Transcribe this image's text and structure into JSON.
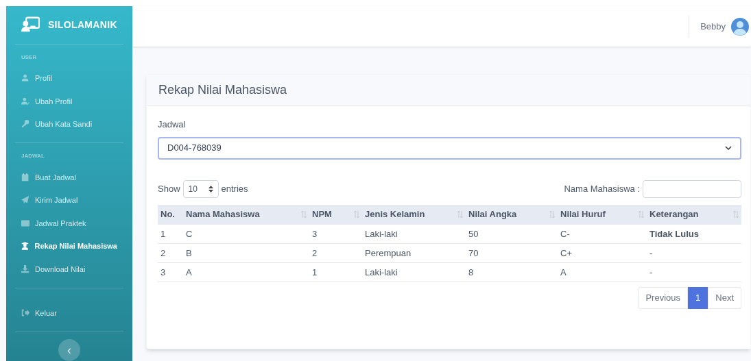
{
  "brand": "SILOLAMANIK",
  "sidebar": {
    "sections": [
      {
        "heading": "USER",
        "items": [
          {
            "label": "Profil",
            "kind": "user",
            "selected": false
          },
          {
            "label": "Ubah Profil",
            "kind": "user-edit",
            "selected": false
          },
          {
            "label": "Ubah Kata Sandi",
            "kind": "key",
            "selected": false
          }
        ]
      },
      {
        "heading": "JADWAL",
        "items": [
          {
            "label": "Buat Jadwal",
            "kind": "calendar",
            "selected": false
          },
          {
            "label": "Kirim Jadwal",
            "kind": "plane",
            "selected": false
          },
          {
            "label": "Jadwal Praktek",
            "kind": "card",
            "selected": false
          },
          {
            "label": "Rekap Nilai Mahasiswa",
            "kind": "graduate",
            "selected": true
          },
          {
            "label": "Download Nilai",
            "kind": "download",
            "selected": false
          }
        ]
      },
      {
        "items": [
          {
            "label": "Keluar",
            "kind": "logout",
            "selected": false
          }
        ]
      }
    ],
    "collapse_button": "‹"
  },
  "topbar": {
    "user_name": "Bebby"
  },
  "card": {
    "title": "Rekap Nilai Mahasiswa",
    "field_label": "Jadwal",
    "select_value": "D004-768039",
    "length": {
      "before": "Show",
      "value": "10",
      "after": "entries"
    },
    "search_label": "Nama Mahasiswa :",
    "table": {
      "columns": [
        {
          "label": "No.",
          "sortable": false
        },
        {
          "label": "Nama Mahasiswa",
          "sortable": true
        },
        {
          "label": "NPM",
          "sortable": true
        },
        {
          "label": "Jenis Kelamin",
          "sortable": true
        },
        {
          "label": "Nilai Angka",
          "sortable": true
        },
        {
          "label": "Nilai Huruf",
          "sortable": true
        },
        {
          "label": "Keterangan",
          "sortable": true
        }
      ],
      "rows": [
        {
          "cells": [
            "1",
            "C",
            "3",
            "Laki-laki",
            "50",
            "C-",
            "Tidak Lulus"
          ],
          "emphasis": true
        },
        {
          "cells": [
            "2",
            "B",
            "2",
            "Perempuan",
            "70",
            "C+",
            "-"
          ],
          "emphasis": false
        },
        {
          "cells": [
            "3",
            "A",
            "1",
            "Laki-laki",
            "8",
            "A",
            "-"
          ],
          "emphasis": false
        }
      ]
    },
    "pagination": [
      {
        "label": "Previous",
        "selected": false
      },
      {
        "label": "1",
        "selected": true
      },
      {
        "label": "Next",
        "selected": false
      }
    ]
  }
}
